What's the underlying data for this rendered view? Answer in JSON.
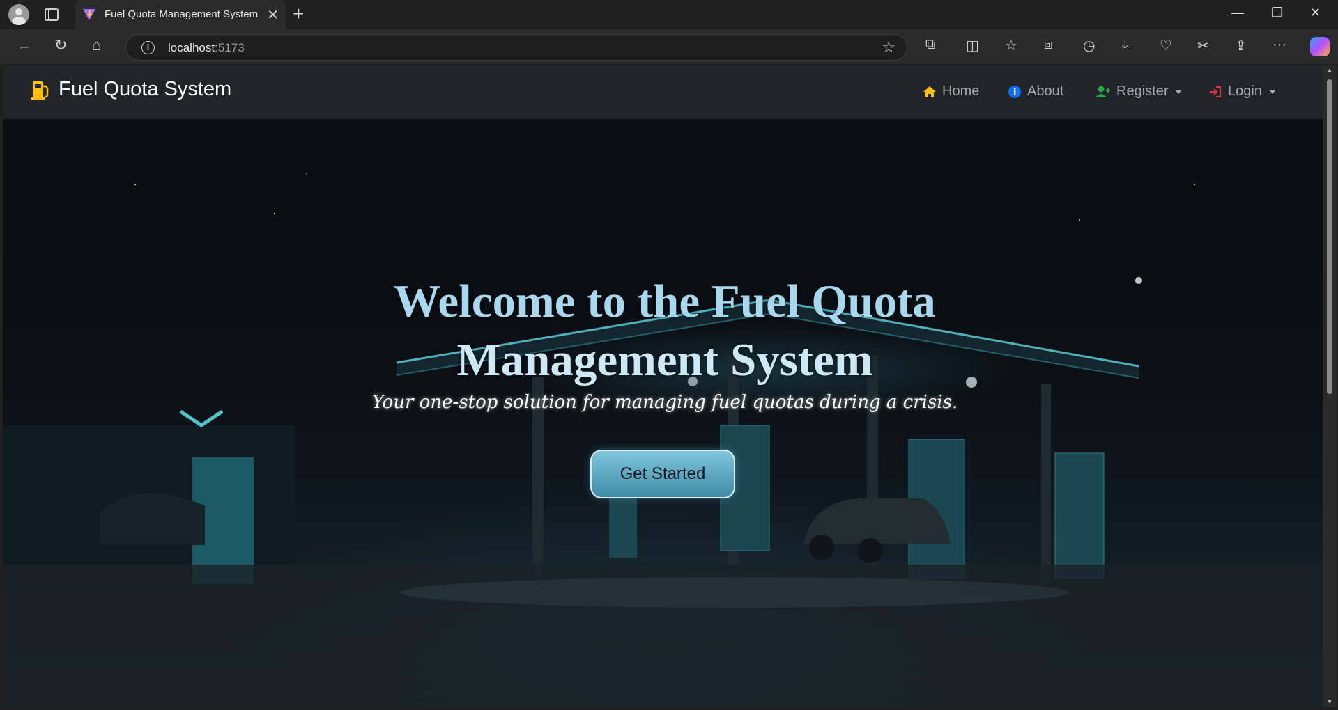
{
  "browser": {
    "tab_title": "Fuel Quota Management System",
    "url_host": "localhost",
    "url_port": ":5173"
  },
  "navbar": {
    "brand": "Fuel Quota System",
    "links": [
      {
        "label": "Home",
        "icon": "home-icon",
        "color": "#ffc107"
      },
      {
        "label": "About",
        "icon": "info-icon",
        "color": "#0d6efd"
      },
      {
        "label": "Register",
        "icon": "user-plus-icon",
        "color": "#28a745",
        "dropdown": true
      },
      {
        "label": "Login",
        "icon": "login-icon",
        "color": "#dc3545",
        "dropdown": true
      }
    ]
  },
  "hero": {
    "title_line1": "Welcome to the Fuel Quota",
    "title_line2": "Management System",
    "subtitle": "Your one-stop solution for managing fuel quotas during a crisis.",
    "cta_label": "Get Started"
  }
}
